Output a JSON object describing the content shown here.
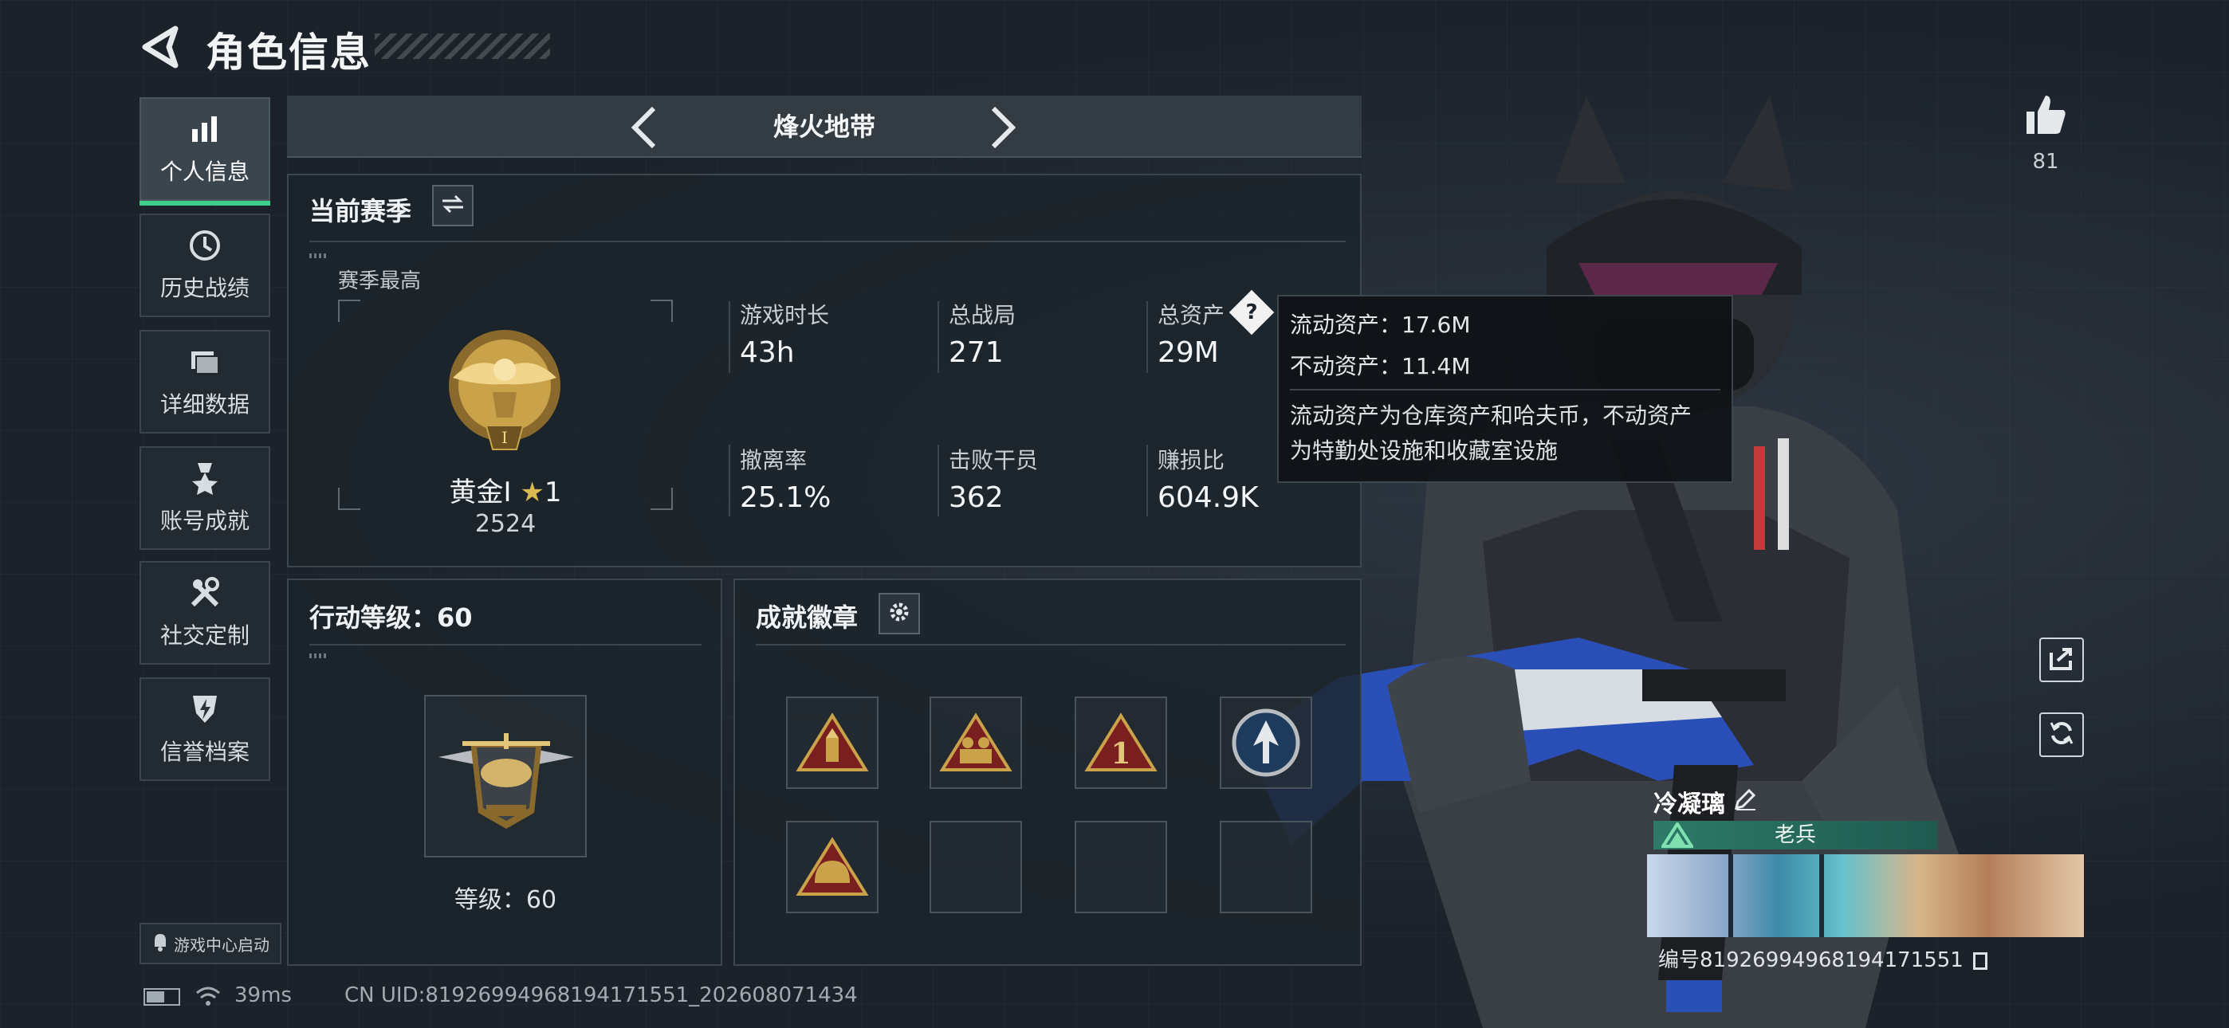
{
  "header": {
    "title": "角色信息"
  },
  "sidebar": {
    "items": [
      {
        "label": "个人信息",
        "icon": "bar-chart-icon",
        "active": true
      },
      {
        "label": "历史战绩",
        "icon": "history-icon",
        "active": false
      },
      {
        "label": "详细数据",
        "icon": "folder-icon",
        "active": false
      },
      {
        "label": "账号成就",
        "icon": "medal-icon",
        "active": false
      },
      {
        "label": "社交定制",
        "icon": "tools-icon",
        "active": false
      },
      {
        "label": "信誉档案",
        "icon": "shield-icon",
        "active": false
      }
    ],
    "game_center": "游戏中心启动"
  },
  "mode": {
    "name": "烽火地带"
  },
  "season": {
    "title": "当前赛季",
    "best_label": "赛季最高",
    "rank_name": "黄金I",
    "rank_stars": "1",
    "rank_score": "2524",
    "stats": [
      {
        "label": "游戏时长",
        "value": "43h"
      },
      {
        "label": "总战局",
        "value": "271"
      },
      {
        "label": "总资产",
        "value": "29M"
      },
      {
        "label": "撤离率",
        "value": "25.1%"
      },
      {
        "label": "击败干员",
        "value": "362"
      },
      {
        "label": "赚损比",
        "value": "604.9K"
      }
    ],
    "help_mark": "?"
  },
  "tooltip": {
    "liquid": "流动资产：17.6M",
    "fixed": "不动资产：11.4M",
    "desc_line1": "流动资产为仓库资产和哈夫币，不动资产",
    "desc_line2": "为特勤处设施和收藏室设施"
  },
  "action_level": {
    "title": "行动等级：60",
    "level_text": "等级：60"
  },
  "achievements": {
    "title": "成就徽章",
    "badges": [
      "ammo-badge-icon",
      "squad-badge-icon",
      "rank-one-badge-icon",
      "arrow-badge-icon",
      "helmet-badge-icon",
      "",
      "",
      ""
    ]
  },
  "social": {
    "likes": "81"
  },
  "player": {
    "name": "冷凝璃",
    "rank": "老兵",
    "id_text": "编号81926994968194171551"
  },
  "status": {
    "ping": "39ms",
    "uid": "CN UID:81926994968194171551_202608071434"
  },
  "colors": {
    "accent_green": "#3ed08a",
    "panel_border": "#3c464f",
    "gold": "#c9a24a"
  }
}
